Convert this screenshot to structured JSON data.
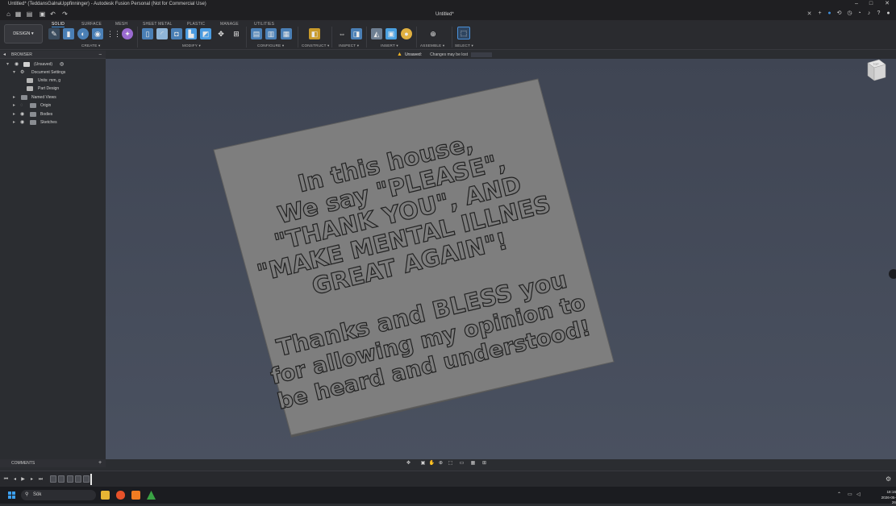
{
  "window": {
    "title": "Untitled* (TeddansGalnaUppfinninger) - Autodesk Fusion Personal (Not for Commercial Use)",
    "document_tab": "Untitled*",
    "controls": [
      "–",
      "□",
      "✕"
    ]
  },
  "ribbon": {
    "workspace_button": "DESIGN",
    "tabs": [
      "SOLID",
      "SURFACE",
      "MESH",
      "SHEET METAL",
      "PLASTIC",
      "MANAGE",
      "UTILITIES"
    ],
    "active_tab": "SOLID",
    "groups": [
      "CREATE",
      "MODIFY",
      "CONFIGURE",
      "CONSTRUCT",
      "INSPECT",
      "INSERT",
      "ASSEMBLE",
      "SELECT"
    ]
  },
  "notice": {
    "label": "Unsaved:",
    "message": "Changes may be lost"
  },
  "browser": {
    "header": "BROWSER",
    "root": "(Unsaved)",
    "items": [
      {
        "label": "Document Settings"
      },
      {
        "label": "Units: mm, g"
      },
      {
        "label": "Part Design"
      },
      {
        "label": "Named Views"
      },
      {
        "label": "Origin"
      },
      {
        "label": "Bodies"
      },
      {
        "label": "Sketches"
      }
    ]
  },
  "model_text": {
    "lines": [
      "In this house,",
      "We say \"PLEASE\",",
      "\"THANK YOU\", AND",
      "\"MAKE MENTAL ILLNES",
      "GREAT AGAIN\"!",
      "",
      "Thanks and BLESS you",
      "for allowing my opinion to",
      "be heard and understood!"
    ]
  },
  "viewcube": {
    "face": "TOP"
  },
  "comments": {
    "header": "COMMENTS"
  },
  "taskbar": {
    "search_placeholder": "Sök",
    "time": "18:16",
    "date": "2026-05-26"
  },
  "colors": {
    "viewport_top": "#3f4553",
    "viewport_bottom": "#4a5160",
    "plate_face": "#7e7e7e",
    "plate_edge": "#5a5a5a",
    "accent": "#3d8fdd",
    "warning": "#f0b323"
  }
}
